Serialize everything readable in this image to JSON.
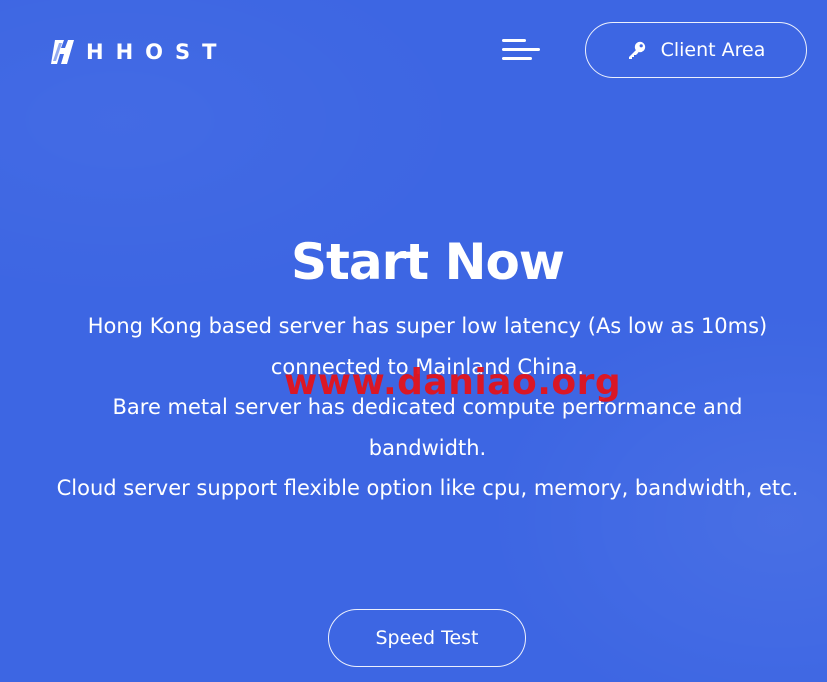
{
  "header": {
    "logo_text": "HHOST",
    "logo_icon": "hhost-logo-icon",
    "menu_icon": "hamburger-menu-icon",
    "client_area": {
      "label": "Client Area",
      "icon": "key-icon"
    }
  },
  "hero": {
    "title": "Start Now",
    "lines": [
      "Hong Kong based server has super low latency (As low as 10ms) connected to Mainland China.",
      "Bare metal server has dedicated compute performance and bandwidth.",
      "Cloud server support flexible option like cpu, memory, bandwidth, etc."
    ],
    "cta_label": "Speed Test"
  },
  "watermark": "www.daniao.org",
  "colors": {
    "background": "#3d66e3",
    "text": "#ffffff",
    "watermark": "#e3131b"
  }
}
